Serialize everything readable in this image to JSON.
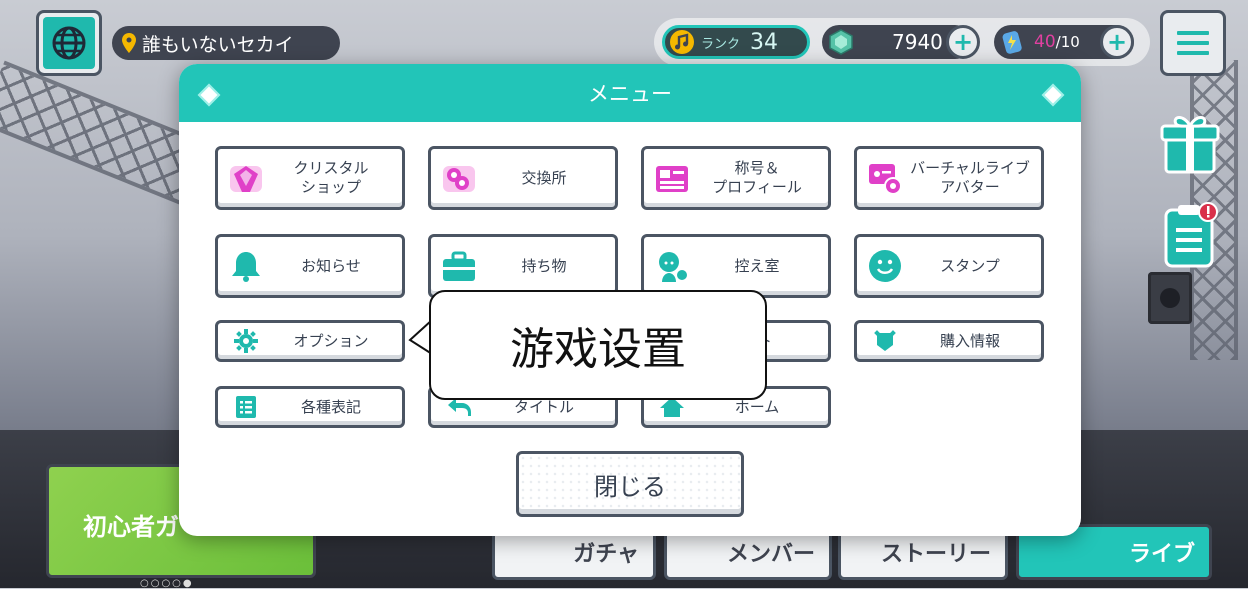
{
  "topbar": {
    "location": "誰もいないセカイ",
    "rank_label": "ランク",
    "rank_value": "34",
    "gems": "7940",
    "energy_current": "40",
    "energy_max": "/10"
  },
  "modal": {
    "title": "メニュー",
    "items": [
      {
        "label": "クリスタル\nショップ",
        "icon": "crystal-icon"
      },
      {
        "label": "交換所",
        "icon": "exchange-icon"
      },
      {
        "label": "称号＆\nプロフィール",
        "icon": "profile-card-icon"
      },
      {
        "label": "バーチャルライブ\nアバター",
        "icon": "avatar-settings-icon"
      },
      {
        "label": "お知らせ",
        "icon": "bell-icon"
      },
      {
        "label": "持ち物",
        "icon": "briefcase-icon"
      },
      {
        "label": "控え室",
        "icon": "waiting-room-icon"
      },
      {
        "label": "スタンプ",
        "icon": "smiley-icon"
      },
      {
        "label": "オプション",
        "icon": "gear-icon"
      },
      {
        "label": "ート",
        "icon": "support-icon"
      },
      {
        "label": "購入情報",
        "icon": "purchase-info-icon"
      },
      {
        "label": "各種表記",
        "icon": "list-icon"
      },
      {
        "label": "タイトル",
        "icon": "return-arrow-icon"
      },
      {
        "label": "ホーム",
        "icon": "home-icon"
      }
    ],
    "close_label": "閉じる"
  },
  "callout": {
    "text": "游戏设置"
  },
  "bottom_nav": {
    "guide_label": "初心者ガ",
    "gacha": "ガチャ",
    "members": "メンバー",
    "story": "ストーリー",
    "live": "ライブ"
  },
  "colors": {
    "accent": "#22c5b8",
    "magenta": "#e040c8",
    "border": "#4b5563"
  }
}
